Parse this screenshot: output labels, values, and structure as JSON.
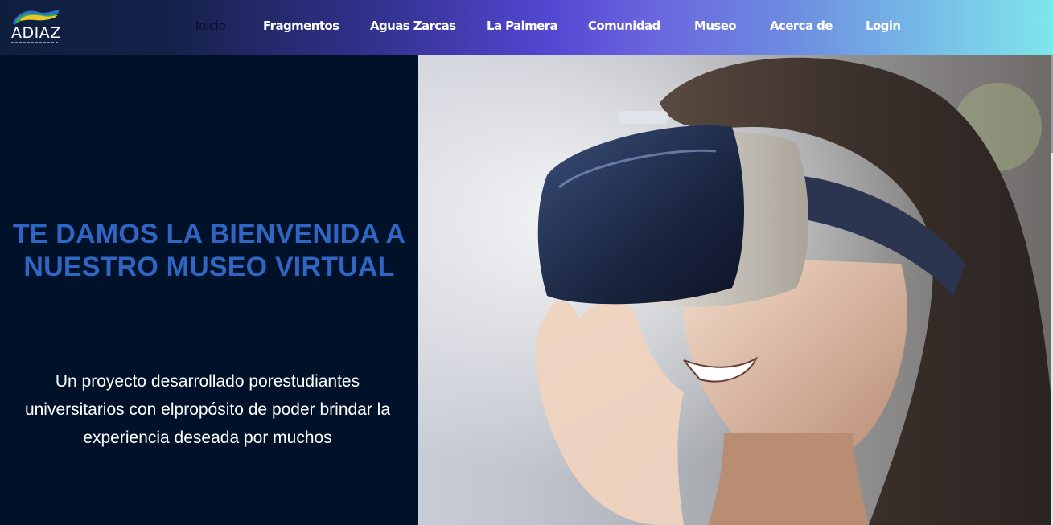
{
  "brand": {
    "logo_text": "ADIAZ"
  },
  "nav": {
    "items": [
      {
        "label": "Inicio"
      },
      {
        "label": "Fragmentos"
      },
      {
        "label": "Aguas Zarcas"
      },
      {
        "label": "La Palmera"
      },
      {
        "label": "Comunidad"
      },
      {
        "label": "Museo"
      },
      {
        "label": "Acerca de"
      },
      {
        "label": "Login"
      }
    ],
    "active_index": 0
  },
  "hero": {
    "title": "TE DAMOS LA BIENVENIDA A NUESTRO MUSEO VIRTUAL",
    "subtitle": "Un proyecto desarrollado porestudiantes universitarios con elpropósito de poder brindar la experiencia deseada por muchos"
  },
  "colors": {
    "hero_bg": "#00112a",
    "title": "#2f66c3",
    "nav_gradient_start": "#0e1f3e",
    "nav_gradient_mid": "#5346d2",
    "nav_gradient_end": "#7fe6eb"
  }
}
